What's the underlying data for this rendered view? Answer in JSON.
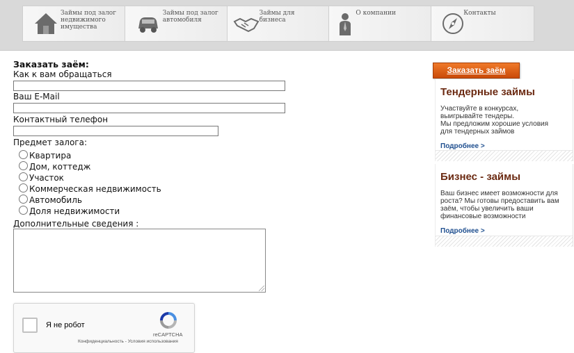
{
  "nav": {
    "items": [
      {
        "label": "Займы под залог недвижимого имущества",
        "icon": "house-icon"
      },
      {
        "label": "Займы под залог автомобиля",
        "icon": "car-icon"
      },
      {
        "label": "Займы для бизнеса",
        "icon": "handshake-icon"
      },
      {
        "label": "О компании",
        "icon": "person-icon"
      },
      {
        "label": "Контакты",
        "icon": "compass-icon"
      }
    ]
  },
  "form": {
    "title": "Заказать заём:",
    "name_label": "Как к вам обращаться",
    "email_label": "Ваш E-Mail",
    "phone_label": "Контактный телефон",
    "collateral_label": "Предмет залога:",
    "collateral_options": [
      "Квартира",
      "Дом, коттедж",
      "Участок",
      "Коммерческая недвижимость",
      "Автомобиль",
      "Доля недвижимости"
    ],
    "extra_label": "Дополнительные сведения :"
  },
  "captcha": {
    "checkbox_label": "Я не робот",
    "brand": "reCAPTCHA",
    "links": "Конфиденциальность - Условия использования"
  },
  "sidebar": {
    "order_button": "Заказать заём",
    "promos": [
      {
        "title": "Тендерные займы",
        "lines": [
          "Участвуйте в конкурсах,",
          "выигрывайте тендеры.",
          "Мы предложим хорошие условия",
          "для тендерных займов"
        ],
        "more": "Подробнее >"
      },
      {
        "title": "Бизнес - займы",
        "lines": [
          "Ваш бизнес имеет возможности для",
          "роста? Мы готовы предоставить вам",
          "заём, чтобы увеличить ваши",
          "финансовые возможности"
        ],
        "more": "Подробнее >"
      }
    ]
  },
  "colors": {
    "accent_orange": "#e0631a",
    "promo_title": "#6b2a12",
    "link_blue": "#1f4f8f"
  }
}
